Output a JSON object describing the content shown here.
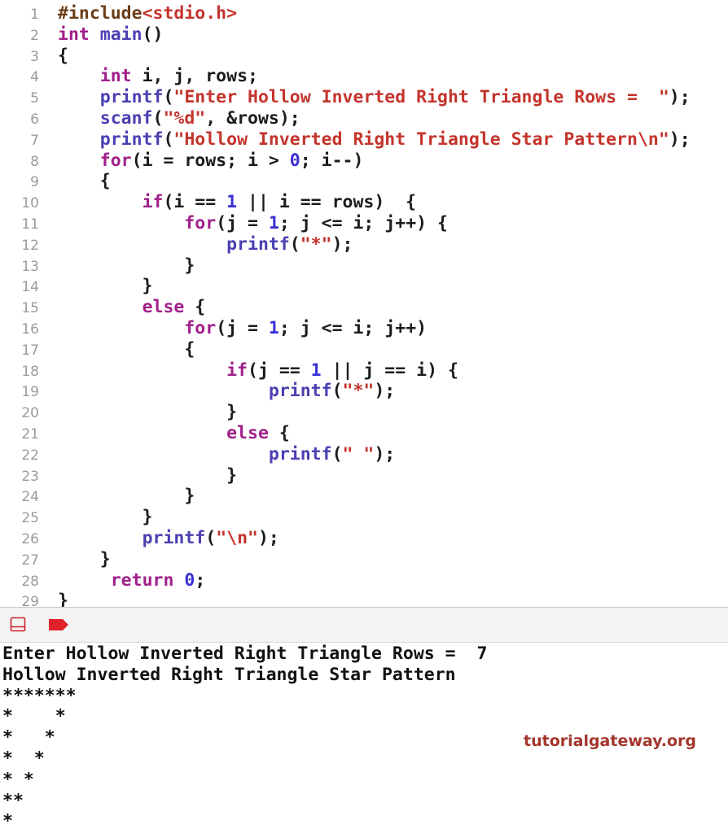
{
  "editor": {
    "lines": [
      {
        "num": "1",
        "tokens": [
          {
            "t": "#include",
            "c": "pp"
          },
          {
            "t": "<stdio.h>",
            "c": "st"
          }
        ]
      },
      {
        "num": "2",
        "tokens": [
          {
            "t": "int",
            "c": "kw"
          },
          {
            "t": " ",
            "c": ""
          },
          {
            "t": "main",
            "c": "fn"
          },
          {
            "t": "()",
            "c": ""
          }
        ]
      },
      {
        "num": "3",
        "tokens": [
          {
            "t": "{",
            "c": ""
          }
        ]
      },
      {
        "num": "4",
        "tokens": [
          {
            "t": "    ",
            "c": ""
          },
          {
            "t": "int",
            "c": "kw"
          },
          {
            "t": " i, j, rows;",
            "c": ""
          }
        ]
      },
      {
        "num": "5",
        "tokens": [
          {
            "t": "    ",
            "c": ""
          },
          {
            "t": "printf",
            "c": "fn"
          },
          {
            "t": "(",
            "c": ""
          },
          {
            "t": "\"Enter Hollow Inverted Right Triangle Rows =  \"",
            "c": "st"
          },
          {
            "t": ");",
            "c": ""
          }
        ]
      },
      {
        "num": "6",
        "tokens": [
          {
            "t": "    ",
            "c": ""
          },
          {
            "t": "scanf",
            "c": "fn"
          },
          {
            "t": "(",
            "c": ""
          },
          {
            "t": "\"%d\"",
            "c": "st"
          },
          {
            "t": ", &rows);",
            "c": ""
          }
        ]
      },
      {
        "num": "7",
        "tokens": [
          {
            "t": "    ",
            "c": ""
          },
          {
            "t": "printf",
            "c": "fn"
          },
          {
            "t": "(",
            "c": ""
          },
          {
            "t": "\"Hollow Inverted Right Triangle Star Pattern\\n\"",
            "c": "st"
          },
          {
            "t": ");",
            "c": ""
          }
        ]
      },
      {
        "num": "8",
        "tokens": [
          {
            "t": "    ",
            "c": ""
          },
          {
            "t": "for",
            "c": "kw"
          },
          {
            "t": "(i = rows; i > ",
            "c": ""
          },
          {
            "t": "0",
            "c": "nm"
          },
          {
            "t": "; i--)",
            "c": ""
          }
        ]
      },
      {
        "num": "9",
        "tokens": [
          {
            "t": "    {",
            "c": ""
          }
        ]
      },
      {
        "num": "10",
        "tokens": [
          {
            "t": "        ",
            "c": ""
          },
          {
            "t": "if",
            "c": "kw"
          },
          {
            "t": "(i == ",
            "c": ""
          },
          {
            "t": "1",
            "c": "nm"
          },
          {
            "t": " || i == rows)  {",
            "c": ""
          }
        ]
      },
      {
        "num": "11",
        "tokens": [
          {
            "t": "            ",
            "c": ""
          },
          {
            "t": "for",
            "c": "kw"
          },
          {
            "t": "(j = ",
            "c": ""
          },
          {
            "t": "1",
            "c": "nm"
          },
          {
            "t": "; j <= i; j++) {",
            "c": ""
          }
        ]
      },
      {
        "num": "12",
        "tokens": [
          {
            "t": "                ",
            "c": ""
          },
          {
            "t": "printf",
            "c": "fn"
          },
          {
            "t": "(",
            "c": ""
          },
          {
            "t": "\"*\"",
            "c": "st"
          },
          {
            "t": ");",
            "c": ""
          }
        ]
      },
      {
        "num": "13",
        "tokens": [
          {
            "t": "            }",
            "c": ""
          }
        ]
      },
      {
        "num": "14",
        "tokens": [
          {
            "t": "        }",
            "c": ""
          }
        ]
      },
      {
        "num": "15",
        "tokens": [
          {
            "t": "        ",
            "c": ""
          },
          {
            "t": "else",
            "c": "kw"
          },
          {
            "t": " {",
            "c": ""
          }
        ]
      },
      {
        "num": "16",
        "tokens": [
          {
            "t": "            ",
            "c": ""
          },
          {
            "t": "for",
            "c": "kw"
          },
          {
            "t": "(j = ",
            "c": ""
          },
          {
            "t": "1",
            "c": "nm"
          },
          {
            "t": "; j <= i; j++)",
            "c": ""
          }
        ]
      },
      {
        "num": "17",
        "tokens": [
          {
            "t": "            {",
            "c": ""
          }
        ]
      },
      {
        "num": "18",
        "tokens": [
          {
            "t": "                ",
            "c": ""
          },
          {
            "t": "if",
            "c": "kw"
          },
          {
            "t": "(j == ",
            "c": ""
          },
          {
            "t": "1",
            "c": "nm"
          },
          {
            "t": " || j == i) {",
            "c": ""
          }
        ]
      },
      {
        "num": "19",
        "tokens": [
          {
            "t": "                    ",
            "c": ""
          },
          {
            "t": "printf",
            "c": "fn"
          },
          {
            "t": "(",
            "c": ""
          },
          {
            "t": "\"*\"",
            "c": "st"
          },
          {
            "t": ");",
            "c": ""
          }
        ]
      },
      {
        "num": "20",
        "tokens": [
          {
            "t": "                }",
            "c": ""
          }
        ]
      },
      {
        "num": "21",
        "tokens": [
          {
            "t": "                ",
            "c": ""
          },
          {
            "t": "else",
            "c": "kw"
          },
          {
            "t": " {",
            "c": ""
          }
        ]
      },
      {
        "num": "22",
        "tokens": [
          {
            "t": "                    ",
            "c": ""
          },
          {
            "t": "printf",
            "c": "fn"
          },
          {
            "t": "(",
            "c": ""
          },
          {
            "t": "\" \"",
            "c": "st"
          },
          {
            "t": ");",
            "c": ""
          }
        ]
      },
      {
        "num": "23",
        "tokens": [
          {
            "t": "                }",
            "c": ""
          }
        ]
      },
      {
        "num": "24",
        "tokens": [
          {
            "t": "            }",
            "c": ""
          }
        ]
      },
      {
        "num": "25",
        "tokens": [
          {
            "t": "        }",
            "c": ""
          }
        ]
      },
      {
        "num": "26",
        "tokens": [
          {
            "t": "        ",
            "c": ""
          },
          {
            "t": "printf",
            "c": "fn"
          },
          {
            "t": "(",
            "c": ""
          },
          {
            "t": "\"\\n\"",
            "c": "st"
          },
          {
            "t": ");",
            "c": ""
          }
        ]
      },
      {
        "num": "27",
        "tokens": [
          {
            "t": "    }",
            "c": ""
          }
        ]
      },
      {
        "num": "28",
        "tokens": [
          {
            "t": "     ",
            "c": ""
          },
          {
            "t": "return",
            "c": "kw"
          },
          {
            "t": " ",
            "c": ""
          },
          {
            "t": "0",
            "c": "nm"
          },
          {
            "t": ";",
            "c": ""
          }
        ]
      },
      {
        "num": "29",
        "tokens": [
          {
            "t": "}",
            "c": ""
          }
        ]
      }
    ]
  },
  "toolbar": {
    "panel_icon": "hide-debug-area-icon",
    "breakpoint_icon": "breakpoint-icon",
    "breakpoint_color": "#e0222c"
  },
  "console": {
    "lines": [
      "Enter Hollow Inverted Right Triangle Rows =  7",
      "Hollow Inverted Right Triangle Star Pattern",
      "*******",
      "*    *",
      "*   *",
      "*  *",
      "* *",
      "**",
      "*"
    ]
  },
  "watermark": {
    "text": "tutorialgateway.org",
    "color": "#a3352c"
  }
}
